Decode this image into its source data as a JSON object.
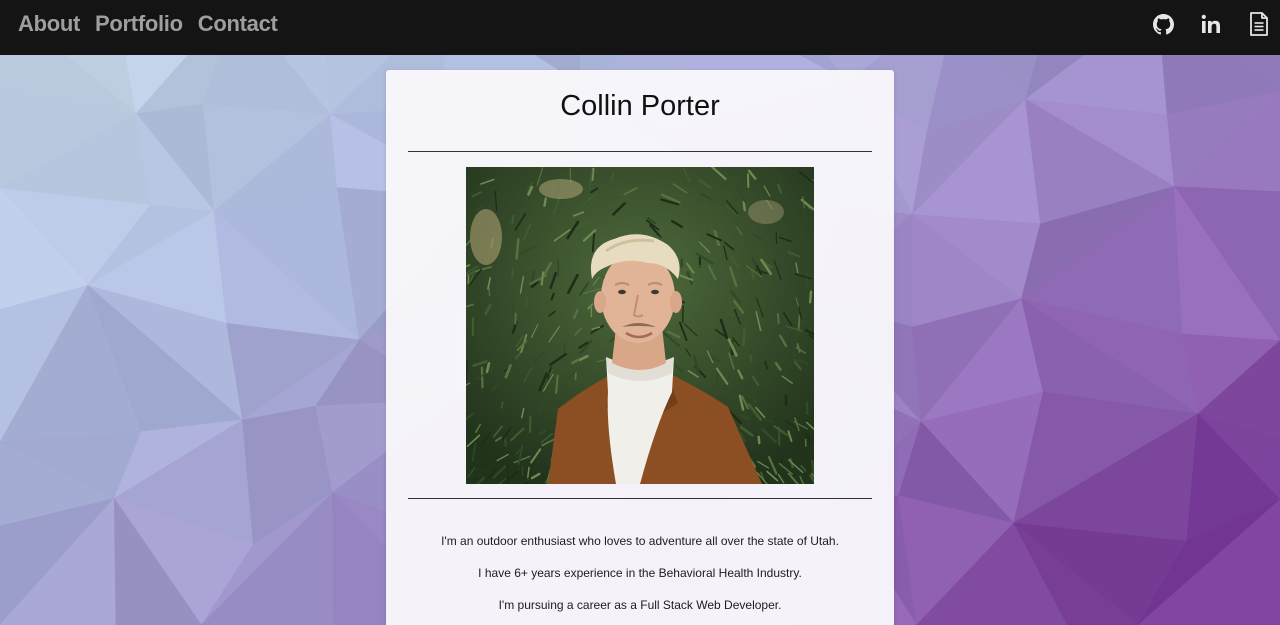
{
  "nav": {
    "links": [
      "About",
      "Portfolio",
      "Contact"
    ],
    "icons": [
      "github-icon",
      "linkedin-icon",
      "resume-document-icon"
    ]
  },
  "profile": {
    "name": "Collin Porter",
    "bio": [
      "I'm an outdoor enthusiast who loves to adventure all over the state of Utah.",
      "I have 6+ years experience in the Behavioral Health Industry.",
      "I'm pursuing a career as a Full Stack Web Developer."
    ]
  },
  "colors": {
    "navbar": "#141414",
    "nav_text": "#9e9e9e",
    "card": "#faf9fc",
    "bg_light": "#c8d8ec",
    "bg_purple": "#8a4fa6"
  }
}
